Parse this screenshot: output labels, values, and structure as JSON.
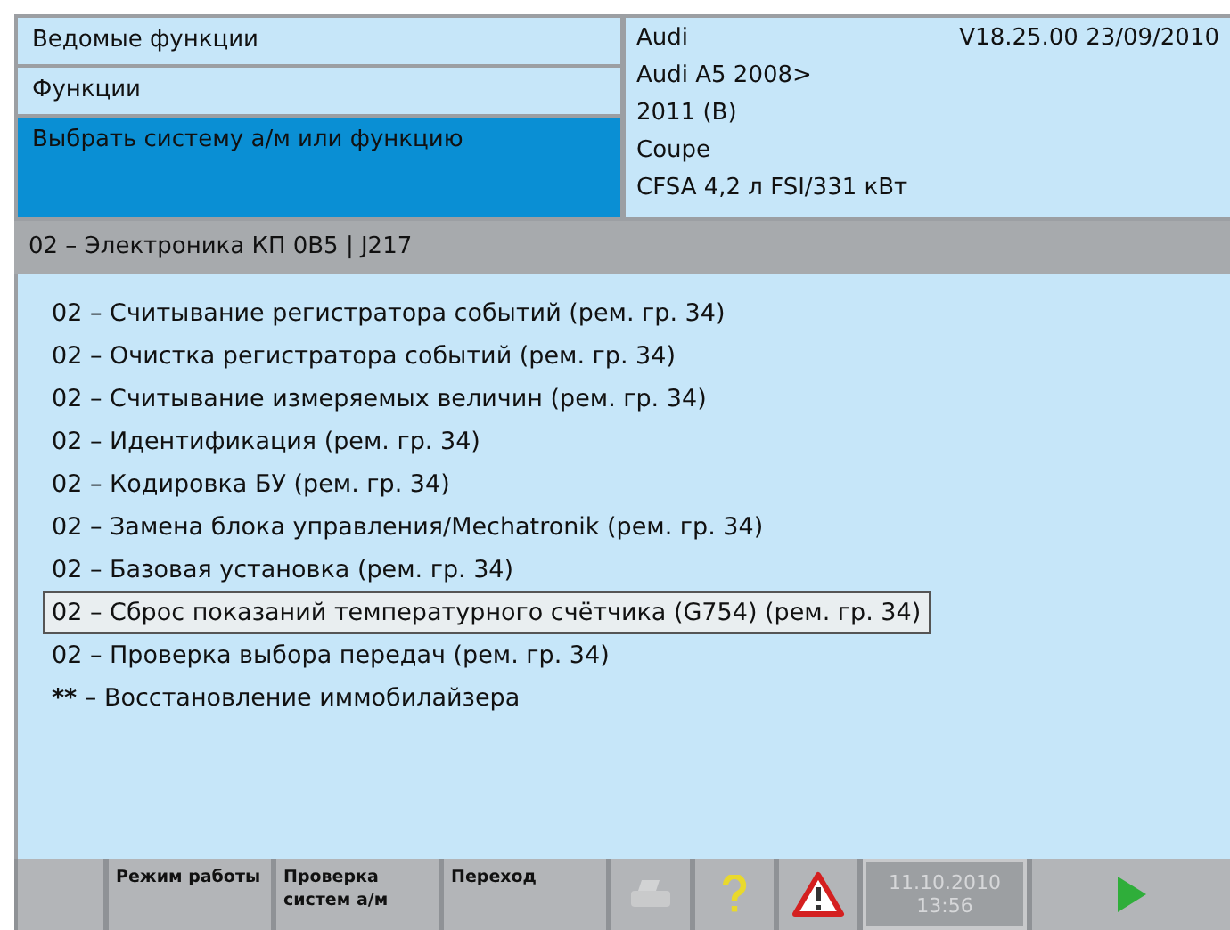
{
  "breadcrumbs": [
    {
      "label": "Ведомые функции",
      "selected": false
    },
    {
      "label": "Функции",
      "selected": false
    },
    {
      "label": "Выбрать систему а/м или функцию",
      "selected": true
    }
  ],
  "vehicle": {
    "brand": "Audi",
    "version": "V18.25.00 23/09/2010",
    "lines": [
      "Audi A5 2008>",
      "2011 (B)",
      "Coupe",
      "CFSA 4,2 л FSI/331 кВт"
    ]
  },
  "system_bar": "02 – Электроника КП 0B5 | J217",
  "functions": [
    {
      "kind": "plain",
      "code": "02",
      "label": "– Считывание регистратора событий (рем. гр. 34)",
      "selected": false
    },
    {
      "kind": "plain",
      "code": "02",
      "label": "– Очистка регистратора событий (рем. гр. 34)",
      "selected": false
    },
    {
      "kind": "plain",
      "code": "02",
      "label": "– Считывание измеряемых величин (рем. гр. 34)",
      "selected": false
    },
    {
      "kind": "plain",
      "code": "02",
      "label": "– Идентификация (рем. гр. 34)",
      "selected": false
    },
    {
      "kind": "plain",
      "code": "02",
      "label": "– Кодировка БУ (рем. гр. 34)",
      "selected": false
    },
    {
      "kind": "plain",
      "code": "02",
      "label": "– Замена блока управления/Mechatronik (рем. гр. 34)",
      "selected": false
    },
    {
      "kind": "plain",
      "code": "02",
      "label": "– Базовая установка (рем. гр. 34)",
      "selected": false
    },
    {
      "kind": "plain",
      "code": "02",
      "label": "– Сброс показаний температурного счётчика (G754) (рем. гр. 34)",
      "selected": true
    },
    {
      "kind": "plain",
      "code": "02",
      "label": "– Проверка выбора передач (рем. гр. 34)",
      "selected": false
    },
    {
      "kind": "marked",
      "code": "**",
      "label": "– Восстановление иммобилайзера",
      "selected": false
    }
  ],
  "toolbar": [
    {
      "kind": "blank"
    },
    {
      "kind": "text",
      "label": "Режим работы"
    },
    {
      "kind": "text",
      "label": "Проверка систем а/м"
    },
    {
      "kind": "text",
      "label": "Переход"
    },
    {
      "kind": "print",
      "disabled": true
    },
    {
      "kind": "help"
    },
    {
      "kind": "warning"
    },
    {
      "kind": "clock",
      "date": "11.10.2010",
      "time": "13:56",
      "disabled": true
    },
    {
      "kind": "next"
    }
  ]
}
